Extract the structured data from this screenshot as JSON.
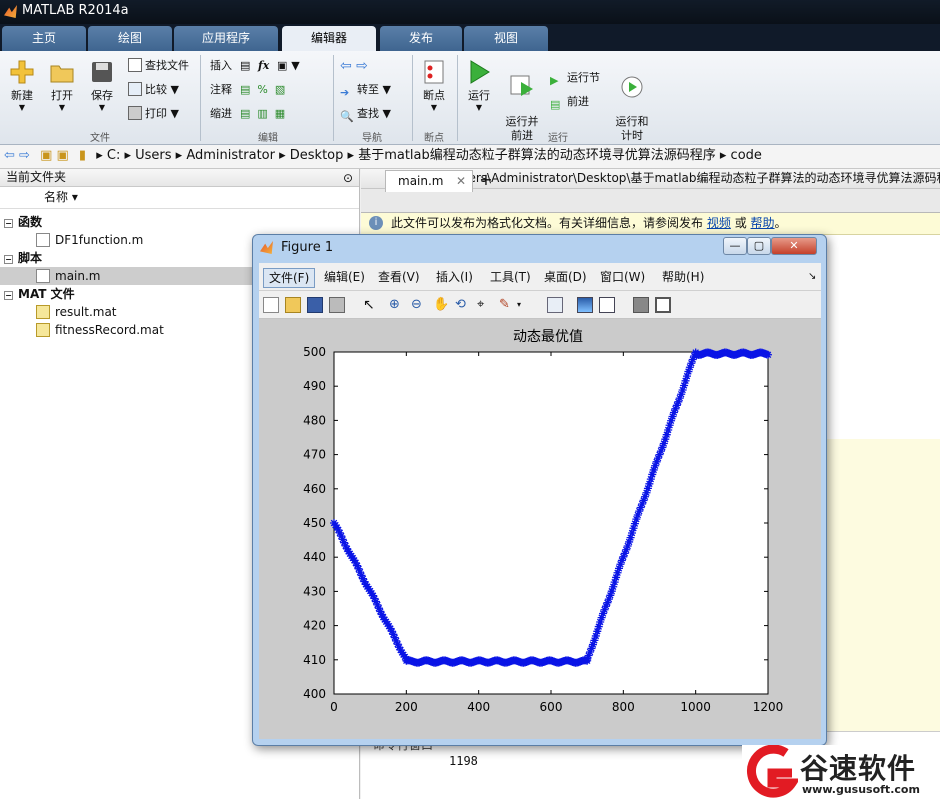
{
  "window": {
    "title": "MATLAB R2014a"
  },
  "tabs": [
    "主页",
    "绘图",
    "应用程序",
    "编辑器",
    "发布",
    "视图"
  ],
  "ribbon": {
    "new": "新建",
    "open": "打开",
    "save": "保存",
    "find_files": "查找文件",
    "compare": "比较",
    "print": "打印",
    "insert": "插入",
    "comment": "注释",
    "indent": "缩进",
    "goto": "转至",
    "find": "查找",
    "breakpoints": "断点",
    "run": "运行",
    "run_advance": "运行并\n前进",
    "run_section": "运行节",
    "advance": "前进",
    "run_time": "运行和\n计时",
    "sections": {
      "file": "文件",
      "edit": "编辑",
      "nav": "导航",
      "bp": "断点",
      "run": "运行"
    }
  },
  "address": {
    "crumbs": [
      "C:",
      "Users",
      "Administrator",
      "Desktop",
      "基于matlab编程动态粒子群算法的动态环境寻优算法源码程序",
      "code"
    ]
  },
  "left": {
    "header": "当前文件夹",
    "col_name": "名称",
    "groups": [
      {
        "label": "函数",
        "items": [
          "DF1function.m"
        ]
      },
      {
        "label": "脚本",
        "items": [
          "main.m"
        ]
      },
      {
        "label": "MAT 文件",
        "items": [
          "result.mat",
          "fitnessRecord.mat"
        ]
      }
    ]
  },
  "editor": {
    "title": "编辑器 - C:\\Users\\Administrator\\Desktop\\基于matlab编程动态粒子群算法的动态环境寻优算法源码程",
    "tab": "main.m",
    "info_text": "此文件可以发布为格式化文档。有关详细信息，请参阅发布",
    "info_link1": "视频",
    "info_or": "或",
    "info_link2": "帮助",
    "info_end": "。",
    "cmd_label": "命令行窗口",
    "cmd_value": "1198"
  },
  "figure": {
    "title": "Figure 1",
    "menus": [
      "文件(F)",
      "编辑(E)",
      "查看(V)",
      "插入(I)",
      "工具(T)",
      "桌面(D)",
      "窗口(W)",
      "帮助(H)"
    ]
  },
  "watermark": {
    "name": "谷速软件",
    "url": "www.gususoft.com"
  },
  "colors": {
    "series": "#0a14e6",
    "accent": "#3f6590"
  },
  "chart_data": {
    "type": "scatter",
    "title": "动态最优值",
    "xlabel": "",
    "ylabel": "",
    "xlim": [
      0,
      1200
    ],
    "ylim": [
      400,
      500
    ],
    "xticks": [
      0,
      200,
      400,
      600,
      800,
      1000,
      1200
    ],
    "yticks": [
      400,
      410,
      420,
      430,
      440,
      450,
      460,
      470,
      480,
      490,
      500
    ],
    "marker": "*",
    "segments": [
      {
        "x0": 0,
        "x1": 200,
        "y0": 450,
        "y1": 410
      },
      {
        "x0": 200,
        "x1": 700,
        "y0": 409.5,
        "y1": 409.5
      },
      {
        "x0": 700,
        "x1": 1000,
        "y0": 410,
        "y1": 500
      },
      {
        "x0": 1000,
        "x1": 1200,
        "y0": 499.5,
        "y1": 499.5
      }
    ],
    "point_count": 1200
  }
}
